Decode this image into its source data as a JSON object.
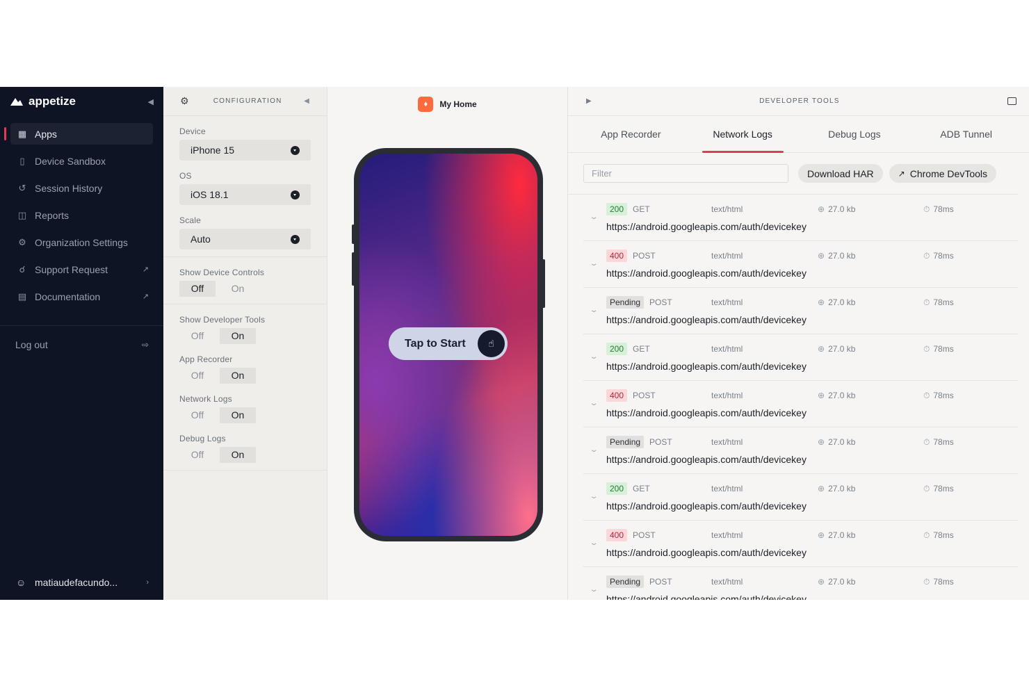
{
  "sidebar": {
    "brand": "appetize",
    "items": [
      {
        "label": "Apps",
        "icon": "grid-icon"
      },
      {
        "label": "Device Sandbox",
        "icon": "phone-icon"
      },
      {
        "label": "Session History",
        "icon": "history-icon"
      },
      {
        "label": "Reports",
        "icon": "inbox-icon"
      },
      {
        "label": "Organization Settings",
        "icon": "gear-icon"
      },
      {
        "label": "Support Request",
        "icon": "support-icon"
      },
      {
        "label": "Documentation",
        "icon": "book-icon"
      }
    ],
    "logout": "Log out",
    "user": "matiaudefacundo..."
  },
  "config": {
    "title": "CONFIGURATION",
    "device_label": "Device",
    "device_value": "iPhone 15",
    "os_label": "OS",
    "os_value": "iOS 18.1",
    "scale_label": "Scale",
    "scale_value": "Auto",
    "toggles": [
      {
        "label": "Show Device Controls",
        "off": "Off",
        "on": "On",
        "selected": "off"
      },
      {
        "label": "Show Developer Tools",
        "off": "Off",
        "on": "On",
        "selected": "on"
      },
      {
        "label": "App Recorder",
        "off": "Off",
        "on": "On",
        "selected": "on"
      },
      {
        "label": "Network Logs",
        "off": "Off",
        "on": "On",
        "selected": "on"
      },
      {
        "label": "Debug Logs",
        "off": "Off",
        "on": "On",
        "selected": "on"
      }
    ]
  },
  "preview": {
    "app_name": "My Home",
    "tap_label": "Tap to Start"
  },
  "devtools": {
    "title": "DEVELOPER TOOLS",
    "tabs": [
      "App Recorder",
      "Network Logs",
      "Debug Logs",
      "ADB Tunnel"
    ],
    "active_tab": "Network Logs",
    "filter_placeholder": "Filter",
    "download_label": "Download HAR",
    "chrome_label": "Chrome DevTools",
    "logs": [
      {
        "status": "200",
        "method": "GET",
        "type": "text/html",
        "size": "27.0 kb",
        "time": "78ms",
        "url": "https://android.googleapis.com/auth/devicekey"
      },
      {
        "status": "400",
        "method": "POST",
        "type": "text/html",
        "size": "27.0 kb",
        "time": "78ms",
        "url": "https://android.googleapis.com/auth/devicekey"
      },
      {
        "status": "Pending",
        "method": "POST",
        "type": "text/html",
        "size": "27.0 kb",
        "time": "78ms",
        "url": "https://android.googleapis.com/auth/devicekey"
      },
      {
        "status": "200",
        "method": "GET",
        "type": "text/html",
        "size": "27.0 kb",
        "time": "78ms",
        "url": "https://android.googleapis.com/auth/devicekey"
      },
      {
        "status": "400",
        "method": "POST",
        "type": "text/html",
        "size": "27.0 kb",
        "time": "78ms",
        "url": "https://android.googleapis.com/auth/devicekey"
      },
      {
        "status": "Pending",
        "method": "POST",
        "type": "text/html",
        "size": "27.0 kb",
        "time": "78ms",
        "url": "https://android.googleapis.com/auth/devicekey"
      },
      {
        "status": "200",
        "method": "GET",
        "type": "text/html",
        "size": "27.0 kb",
        "time": "78ms",
        "url": "https://android.googleapis.com/auth/devicekey"
      },
      {
        "status": "400",
        "method": "POST",
        "type": "text/html",
        "size": "27.0 kb",
        "time": "78ms",
        "url": "https://android.googleapis.com/auth/devicekey"
      },
      {
        "status": "Pending",
        "method": "POST",
        "type": "text/html",
        "size": "27.0 kb",
        "time": "78ms",
        "url": "https://android.googleapis.com/auth/devicekey"
      }
    ]
  },
  "colors": {
    "accent": "#e23a55",
    "sidebar_bg": "#0f1424",
    "status_200": "#2a7a35",
    "status_400": "#b3273a"
  }
}
